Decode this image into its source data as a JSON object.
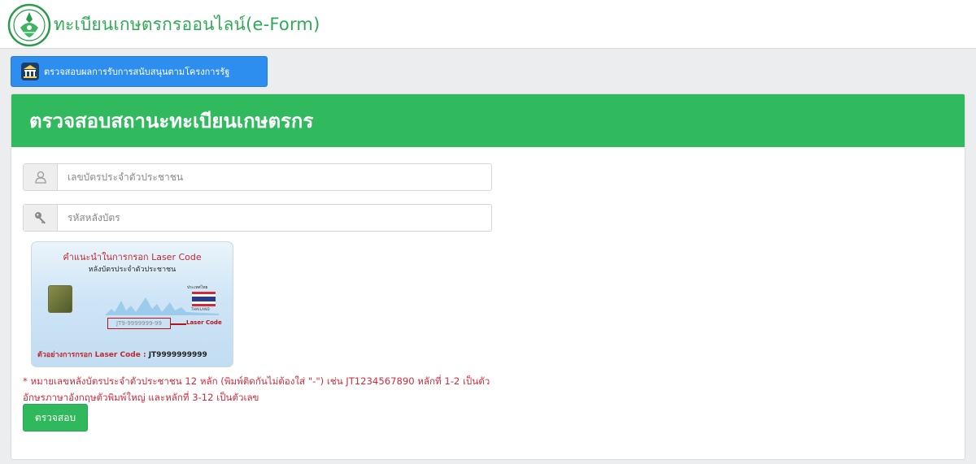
{
  "header": {
    "title": "ทะเบียนเกษตรกรออนไลน์(e-Form)",
    "logo_icon": "ministry-seal-icon"
  },
  "top_button": {
    "label": "ตรวจสอบผลการรับการสนับสนุนตามโครงการรัฐ",
    "icon": "government-building-icon"
  },
  "panel": {
    "title": "ตรวจสอบสถานะทะเบียนเกษตรกร",
    "id_field": {
      "placeholder": "เลขบัตรประจำตัวประชาชน",
      "value": "",
      "icon": "user-icon"
    },
    "laser_field": {
      "placeholder": "รหัสหลังบัตร",
      "value": "",
      "icon": "key-icon"
    },
    "card_image": {
      "title": "คำแนะนำในการกรอก Laser Code",
      "subtitle": "หลังบัตรประจำตัวประชาชน",
      "country_th": "ประเทศไทย",
      "country_en": "THAILAND",
      "sample_code": "JT9-9999999-99",
      "code_label": "Laser Code",
      "example_prefix": "ตัวอย่างการกรอก Laser Code : ",
      "example_code": "JT9999999999"
    },
    "note": "* หมายเลขหลังบัตรประจำตัวประชาชน 12 หลัก (พิมพ์ติดกันไม่ต้องใส่ \"-\") เช่น JT1234567890 หลักที่ 1-2 เป็นตัวอักษรภาษาอังกฤษตัวพิมพ์ใหญ่ และหลักที่ 3-12 เป็นตัวเลข",
    "submit_label": "ตรวจสอบ"
  },
  "colors": {
    "brand_green": "#30b95d",
    "title_green": "#2eaa57",
    "button_blue": "#2d8ef0",
    "note_red": "#d02a3a",
    "page_bg": "#ecedef"
  }
}
